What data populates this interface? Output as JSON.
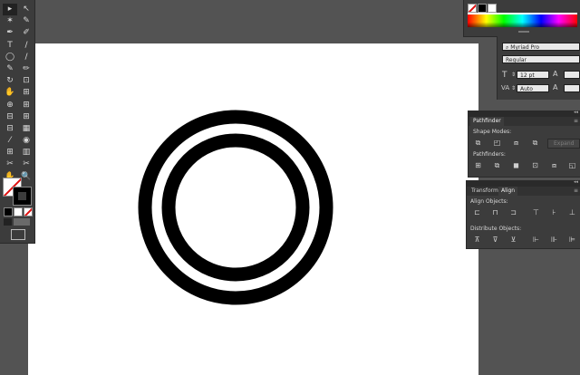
{
  "tools": {
    "rows": [
      [
        "▸",
        "↖"
      ],
      [
        "✶",
        "✎"
      ],
      [
        "✒",
        "✐"
      ],
      [
        "T",
        "/"
      ],
      [
        "◯",
        "/"
      ],
      [
        "✎",
        "✏"
      ],
      [
        "↻",
        "⊡"
      ],
      [
        "✋",
        "⊞"
      ],
      [
        "⊕",
        "⊞"
      ],
      [
        "⊟",
        "⊞"
      ],
      [
        "⊟",
        "▦"
      ],
      [
        "⁄",
        "◉"
      ],
      [
        "⊞",
        "▥"
      ],
      [
        "✂",
        "✂"
      ],
      [
        "✋",
        "🔍"
      ]
    ]
  },
  "character": {
    "font_search_glyph": "⌕",
    "font_family": "Myriad Pro",
    "font_style": "Regular",
    "font_size": "12 pt",
    "leading": "Auto"
  },
  "pathfinder": {
    "tab": "Pathfinder",
    "shape_modes_label": "Shape Modes:",
    "pathfinders_label": "Pathfinders:",
    "expand_label": "Expand"
  },
  "align": {
    "tab_transform": "Transform",
    "tab_align": "Align",
    "align_objects_label": "Align Objects:",
    "distribute_objects_label": "Distribute Objects:"
  },
  "colors": {
    "stroke": "#000000",
    "canvas": "#ffffff",
    "workspace": "#535353",
    "panel": "#3c3c3c"
  }
}
